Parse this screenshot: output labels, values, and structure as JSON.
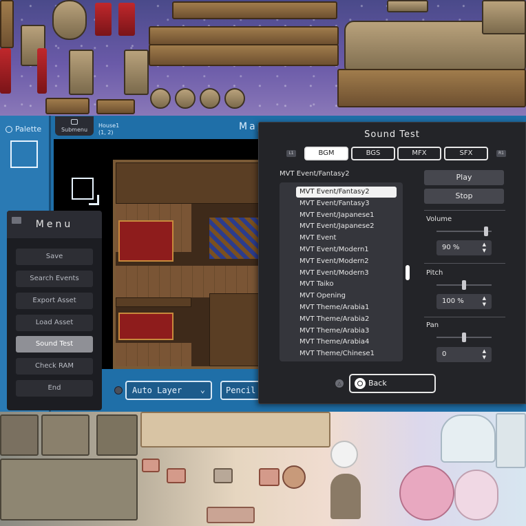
{
  "editor": {
    "palette_label": "Palette",
    "submenu_label": "Submenu",
    "map_name": "House1",
    "map_coords": "(1, 2)",
    "map_title": "Map",
    "layer_mode": "Auto Layer",
    "pen_mode": "Pencil"
  },
  "menu": {
    "title": "Menu",
    "items": [
      "Save",
      "Search Events",
      "Export Asset",
      "Load Asset",
      "Sound Test",
      "Check RAM",
      "End"
    ],
    "active_index": 4
  },
  "sound_test": {
    "title": "Sound Test",
    "left_shoulder": "L1",
    "right_shoulder": "R1",
    "tabs": [
      "BGM",
      "BGS",
      "MFX",
      "SFX"
    ],
    "active_tab": 0,
    "current_track": "MVT Event/Fantasy2",
    "tracks": [
      "MVT Event/Fantasy2",
      "MVT Event/Fantasy3",
      "MVT Event/Japanese1",
      "MVT Event/Japanese2",
      "MVT Event",
      "MVT Event/Modern1",
      "MVT Event/Modern2",
      "MVT Event/Modern3",
      "MVT Taiko",
      "MVT Opening",
      "MVT Theme/Arabia1",
      "MVT Theme/Arabia2",
      "MVT Theme/Arabia3",
      "MVT Theme/Arabia4",
      "MVT Theme/Chinese1"
    ],
    "selected_track": 0,
    "play_label": "Play",
    "stop_label": "Stop",
    "volume_label": "Volume",
    "volume_value": "90 %",
    "volume_level": 0.9,
    "pitch_label": "Pitch",
    "pitch_value": "100 %",
    "pitch_level": 0.5,
    "pan_label": "Pan",
    "pan_value": "0",
    "pan_level": 0.5,
    "back_label": "Back",
    "stepper_arrows": [
      "▲",
      "▼"
    ]
  },
  "icons": {
    "palette": "ps-button-icon",
    "submenu": "submenu-icon",
    "menu": "folder-icon",
    "triangle_button": "triangle-button-icon",
    "back": "circle-button-icon"
  }
}
